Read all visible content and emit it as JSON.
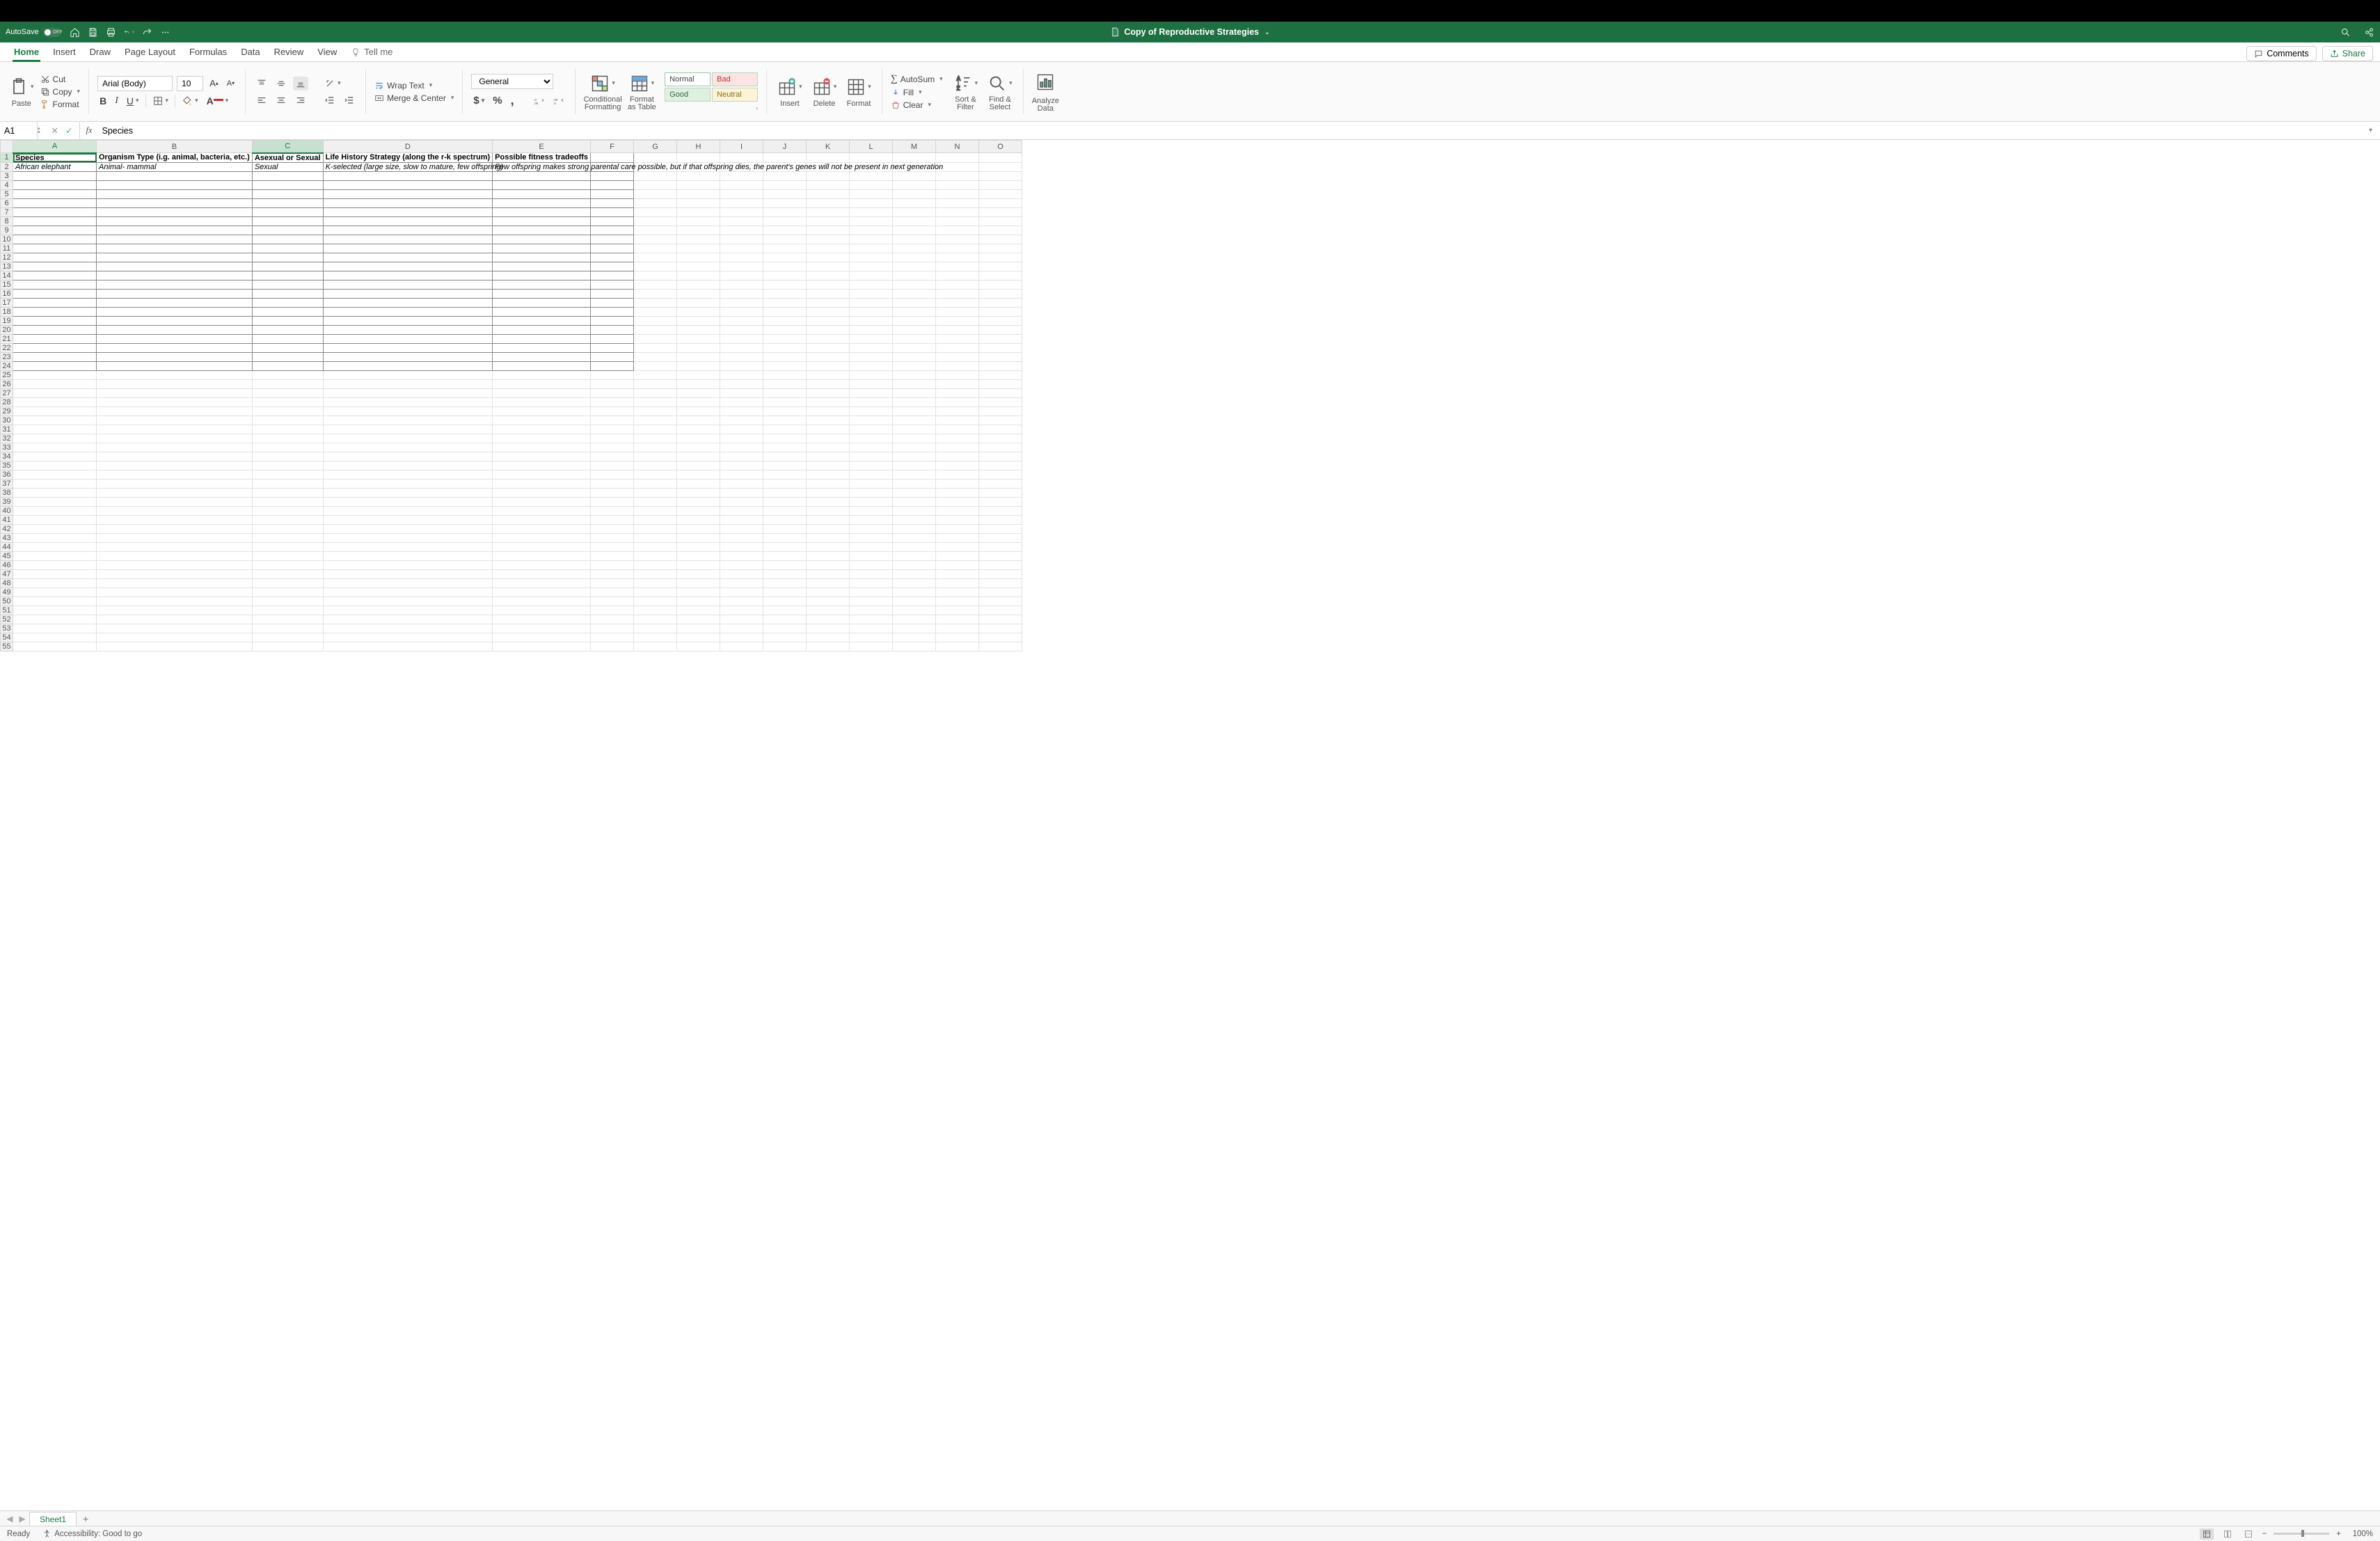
{
  "titlebar": {
    "autosave": "AutoSave",
    "autosave_state": "OFF",
    "filename": "Copy of Reproductive Strategies"
  },
  "tabs": [
    "Home",
    "Insert",
    "Draw",
    "Page Layout",
    "Formulas",
    "Data",
    "Review",
    "View"
  ],
  "active_tab": "Home",
  "tellme": "Tell me",
  "comments_btn": "Comments",
  "share_btn": "Share",
  "ribbon": {
    "clipboard": {
      "paste": "Paste",
      "cut": "Cut",
      "copy": "Copy",
      "format": "Format"
    },
    "font": {
      "name": "Arial (Body)",
      "size": "10"
    },
    "wrap": "Wrap Text",
    "merge": "Merge & Center",
    "number_format": "General",
    "cond_fmt": "Conditional Formatting",
    "fmt_table": "Format as Table",
    "styles": {
      "normal": "Normal",
      "bad": "Bad",
      "good": "Good",
      "neutral": "Neutral"
    },
    "cells": {
      "insert": "Insert",
      "delete": "Delete",
      "format": "Format"
    },
    "editing": {
      "autosum": "AutoSum",
      "fill": "Fill",
      "clear": "Clear",
      "sort": "Sort & Filter",
      "find": "Find & Select"
    },
    "analyze": "Analyze Data"
  },
  "formula_bar": {
    "cell_ref": "A1",
    "content": "Species"
  },
  "columns": [
    {
      "letter": "A",
      "w": 120
    },
    {
      "letter": "B",
      "w": 172
    },
    {
      "letter": "C",
      "w": 94
    },
    {
      "letter": "D",
      "w": 194
    },
    {
      "letter": "E",
      "w": 140
    },
    {
      "letter": "F",
      "w": 62
    },
    {
      "letter": "G",
      "w": 62
    },
    {
      "letter": "H",
      "w": 62
    },
    {
      "letter": "I",
      "w": 62
    },
    {
      "letter": "J",
      "w": 62
    },
    {
      "letter": "K",
      "w": 62
    },
    {
      "letter": "L",
      "w": 62
    },
    {
      "letter": "M",
      "w": 62
    },
    {
      "letter": "N",
      "w": 62
    },
    {
      "letter": "O",
      "w": 62
    }
  ],
  "selected_col_header": "C",
  "active_cell": {
    "row": 1,
    "col": "A"
  },
  "bordered_region": {
    "rows_from": 1,
    "rows_to": 24,
    "cols": [
      "A",
      "B",
      "C",
      "D",
      "E",
      "F"
    ]
  },
  "row_count": 55,
  "data_rows": {
    "1": {
      "A": "Species",
      "B": "Organism Type (i.g. animal, bacteria, etc.)",
      "C": "Asexual or Sexual",
      "D": "Life History Strategy (along the r-k spectrum)",
      "E": "Possible fitness tradeoffs"
    },
    "2": {
      "A": "African elephant",
      "B": "Animal- mammal",
      "C": "Sexual",
      "D": "K-selected (large size, slow to mature, few offspring)",
      "E": "Few offspring makes strong parental care possible, but if that offspring dies, the parent's genes will not be present in next generation"
    }
  },
  "header_row": 1,
  "italic_rows": [
    2
  ],
  "sheet_tabs": [
    "Sheet1"
  ],
  "active_sheet": "Sheet1",
  "status": {
    "ready": "Ready",
    "accessibility": "Accessibility: Good to go",
    "zoom": "100%"
  }
}
